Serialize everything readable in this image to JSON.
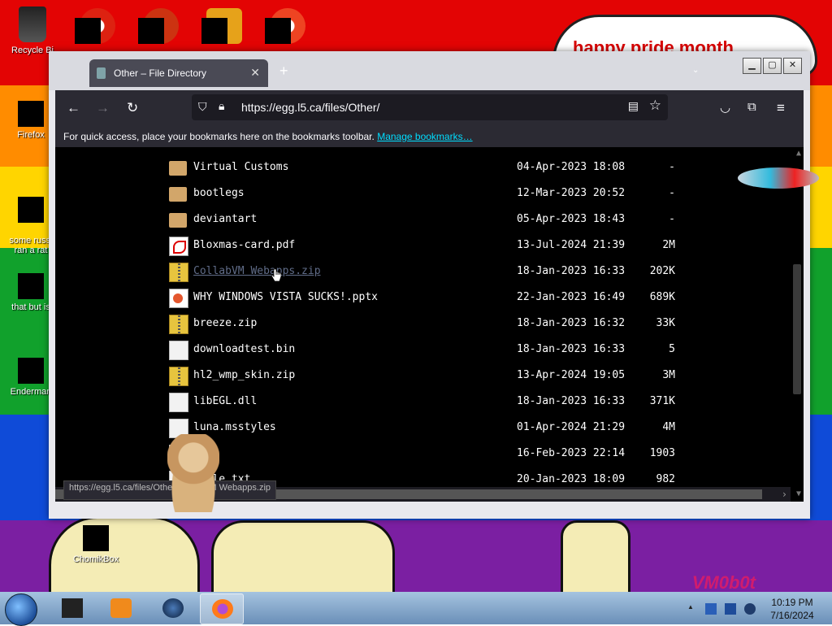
{
  "desktop": {
    "banner_text": "happy pride month",
    "watermark": "VM0b0t",
    "icons": [
      {
        "label": "Recycle Bi"
      },
      {
        "label": "Firefox"
      },
      {
        "label": "some russi\nran a rat"
      },
      {
        "label": "that but is"
      },
      {
        "label": "Enderman"
      },
      {
        "label": "ChomikBox"
      }
    ]
  },
  "browser": {
    "tab_title": "Other – File Directory",
    "url": "https://egg.l5.ca/files/Other/",
    "bookmarks_msg": "For quick access, place your bookmarks here on the bookmarks toolbar.",
    "bookmarks_link": "Manage bookmarks…",
    "status_url": "https://egg.l5.ca/files/Other/CollabVM Webapps.zip",
    "files": [
      {
        "name": "Virtual Customs",
        "date": "04-Apr-2023 18:08",
        "size": "-",
        "type": "folder"
      },
      {
        "name": "bootlegs",
        "date": "12-Mar-2023 20:52",
        "size": "-",
        "type": "folder"
      },
      {
        "name": "deviantart",
        "date": "05-Apr-2023 18:43",
        "size": "-",
        "type": "folder"
      },
      {
        "name": "Bloxmas-card.pdf",
        "date": "13-Jul-2024 21:39",
        "size": "2M",
        "type": "pdf"
      },
      {
        "name": "CollabVM Webapps.zip",
        "date": "18-Jan-2023 16:33",
        "size": "202K",
        "type": "zip"
      },
      {
        "name": "WHY WINDOWS VISTA SUCKS!.pptx",
        "date": "22-Jan-2023 16:49",
        "size": "689K",
        "type": "pptx"
      },
      {
        "name": "breeze.zip",
        "date": "18-Jan-2023 16:32",
        "size": "33K",
        "type": "zip"
      },
      {
        "name": "downloadtest.bin",
        "date": "18-Jan-2023 16:33",
        "size": "5",
        "type": "generic"
      },
      {
        "name": "hl2_wmp_skin.zip",
        "date": "13-Apr-2024 19:05",
        "size": "3M",
        "type": "zip"
      },
      {
        "name": "libEGL.dll",
        "date": "18-Jan-2023 16:33",
        "size": "371K",
        "type": "generic"
      },
      {
        "name": "luna.msstyles",
        "date": "01-Apr-2024 21:29",
        "size": "4M",
        "type": "generic"
      },
      {
        "name": ".txt",
        "date": "16-Feb-2023 22:14",
        "size": "1903",
        "type": "generic"
      },
      {
        "name": "erkle.txt",
        "date": "20-Jan-2023 18:09",
        "size": "982",
        "type": "generic"
      }
    ]
  },
  "taskbar": {
    "time": "10:19 PM",
    "date": "7/16/2024"
  },
  "colors": {
    "accent_link": "#00ddff",
    "browser_toolbar": "#2b2a33"
  }
}
